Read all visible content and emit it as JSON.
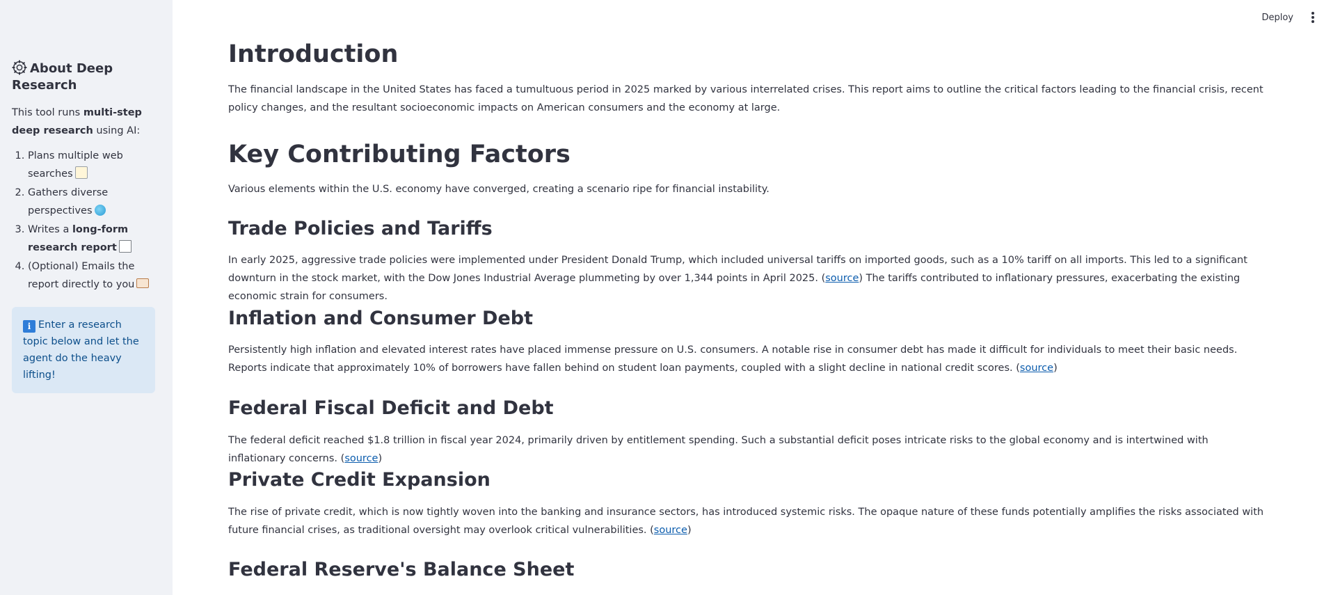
{
  "topbar": {
    "deploy_label": "Deploy",
    "menu_icon": "kebab-menu-icon"
  },
  "sidebar": {
    "title": "About Deep Research",
    "title_icon": "gear-icon",
    "intro_prefix": "This tool runs ",
    "intro_bold": "multi-step deep research",
    "intro_suffix": " using AI:",
    "items": [
      {
        "text_pre": "Plans multiple web searches",
        "bold": "",
        "text_post": "",
        "icon": "memo-icon"
      },
      {
        "text_pre": "Gathers diverse perspectives",
        "bold": "",
        "text_post": "",
        "icon": "globe-icon"
      },
      {
        "text_pre": "Writes a ",
        "bold": "long-form research report",
        "text_post": "",
        "icon": "page-icon"
      },
      {
        "text_pre": "(Optional) Emails the report directly to you",
        "bold": "",
        "text_post": "",
        "icon": "envelope-icon"
      }
    ],
    "info_text": "Enter a research topic below and let the agent do the heavy lifting!",
    "info_icon": "information-icon"
  },
  "report": {
    "link_text": "source",
    "intro_heading": "Introduction",
    "intro_text": "The financial landscape in the United States has faced a tumultuous period in 2025 marked by various interrelated crises. This report aims to outline the critical factors leading to the financial crisis, recent policy changes, and the resultant socioeconomic impacts on American consumers and the economy at large.",
    "factors_heading": "Key Contributing Factors",
    "factors_text": "Various elements within the U.S. economy have converged, creating a scenario ripe for financial instability.",
    "trade_heading": "Trade Policies and Tariffs",
    "trade_text_1": "In early 2025, aggressive trade policies were implemented under President Donald Trump, which included universal tariffs on imported goods, such as a 10% tariff on all imports. This led to a significant downturn in the stock market, with the Dow Jones Industrial Average plummeting by over 1,344 points in April 2025. (",
    "trade_text_2": ") The tariffs contributed to inflationary pressures, exacerbating the existing economic strain for consumers.",
    "inflation_heading": "Inflation and Consumer Debt",
    "inflation_text_1": "Persistently high inflation and elevated interest rates have placed immense pressure on U.S. consumers. A notable rise in consumer debt has made it difficult for individuals to meet their basic needs. Reports indicate that approximately 10% of borrowers have fallen behind on student loan payments, coupled with a slight decline in national credit scores. (",
    "inflation_text_2": ")",
    "deficit_heading": "Federal Fiscal Deficit and Debt",
    "deficit_text_1": "The federal deficit reached $1.8 trillion in fiscal year 2024, primarily driven by entitlement spending. Such a substantial deficit poses intricate risks to the global economy and is intertwined with inflationary concerns. (",
    "deficit_text_2": ")",
    "credit_heading": "Private Credit Expansion",
    "credit_text_1": "The rise of private credit, which is now tightly woven into the banking and insurance sectors, has introduced systemic risks. The opaque nature of these funds potentially amplifies the risks associated with future financial crises, as traditional oversight may overlook critical vulnerabilities. (",
    "credit_text_2": ")",
    "fed_heading": "Federal Reserve's Balance Sheet"
  }
}
